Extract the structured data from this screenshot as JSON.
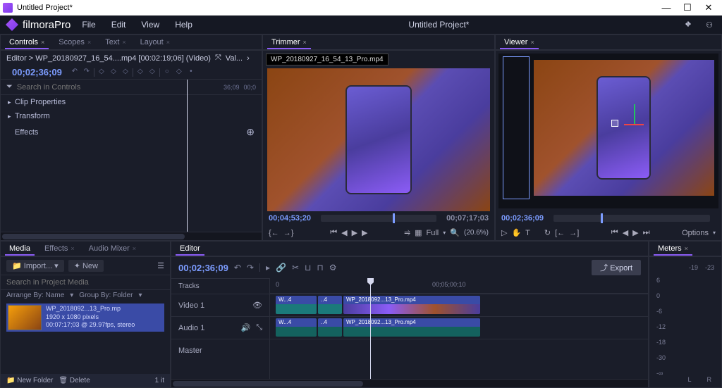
{
  "window": {
    "title": "Untitled Project*"
  },
  "menubar": {
    "brand": "filmoraPro",
    "items": [
      "File",
      "Edit",
      "View",
      "Help"
    ],
    "project": "Untitled Project*"
  },
  "controls": {
    "tabs": [
      {
        "label": "Controls",
        "active": true
      },
      {
        "label": "Scopes",
        "active": false
      },
      {
        "label": "Text",
        "active": false
      },
      {
        "label": "Layout",
        "active": false
      }
    ],
    "crumb": "Editor > WP_20180927_16_54....mp4 [00:02:19;06] (Video)",
    "val_label": "Val...",
    "timecode": "00;02;36;09",
    "search_placeholder": "Search in Controls",
    "ruler_tc": "36;09",
    "ruler_end": "00;0",
    "props": [
      {
        "label": "Clip Properties",
        "expandable": true
      },
      {
        "label": "Transform",
        "expandable": true
      },
      {
        "label": "Effects",
        "expandable": false,
        "plus": true
      }
    ]
  },
  "trimmer": {
    "tabs": [
      {
        "label": "Trimmer",
        "active": true
      }
    ],
    "clip_name": "WP_20180927_16_54_13_Pro.mp4",
    "in_tc": "00;04;53;20",
    "out_tc": "00;07;17;03",
    "scale_label": "Full",
    "zoom": "(20.6%)"
  },
  "viewer": {
    "tabs": [
      {
        "label": "Viewer",
        "active": true
      }
    ],
    "timecode": "00;02;36;09",
    "options": "Options"
  },
  "media": {
    "tabs": [
      {
        "label": "Media",
        "active": true
      },
      {
        "label": "Effects",
        "active": false
      },
      {
        "label": "Audio Mixer",
        "active": false
      }
    ],
    "import": "Import...",
    "new": "New",
    "search_placeholder": "Search in Project Media",
    "arrange": "Arrange By: Name",
    "group": "Group By: Folder",
    "clip": {
      "name": "WP_2018092...13_Pro.mp",
      "res": "1920 x 1080 pixels",
      "meta": "00:07:17;03 @ 29.97fps, stereo"
    },
    "new_folder": "New Folder",
    "delete": "Delete",
    "count": "1 it"
  },
  "editor": {
    "tabs": [
      {
        "label": "Editor",
        "active": true
      }
    ],
    "timecode": "00;02;36;09",
    "export": "Export",
    "tracks_hdr": "Tracks",
    "time_markers": {
      "t0": "0",
      "t1": "00;05;00;10"
    },
    "video_track": "Video 1",
    "audio_track": "Audio 1",
    "master_track": "Master",
    "clip_v1": "W...4",
    "clip_v3": "WP_2018092...13_Pro.mp4",
    "clip_a1": "W...4",
    "clip_a3": "WP_2018092...13_Pro.mp4"
  },
  "meters": {
    "tabs": [
      {
        "label": "Meters",
        "active": true
      }
    ],
    "peak_l": "-19",
    "peak_r": "-23",
    "scale": [
      "6",
      "0",
      "-6",
      "-12",
      "-18",
      "-30",
      "-∞"
    ],
    "L": "L",
    "R": "R"
  }
}
